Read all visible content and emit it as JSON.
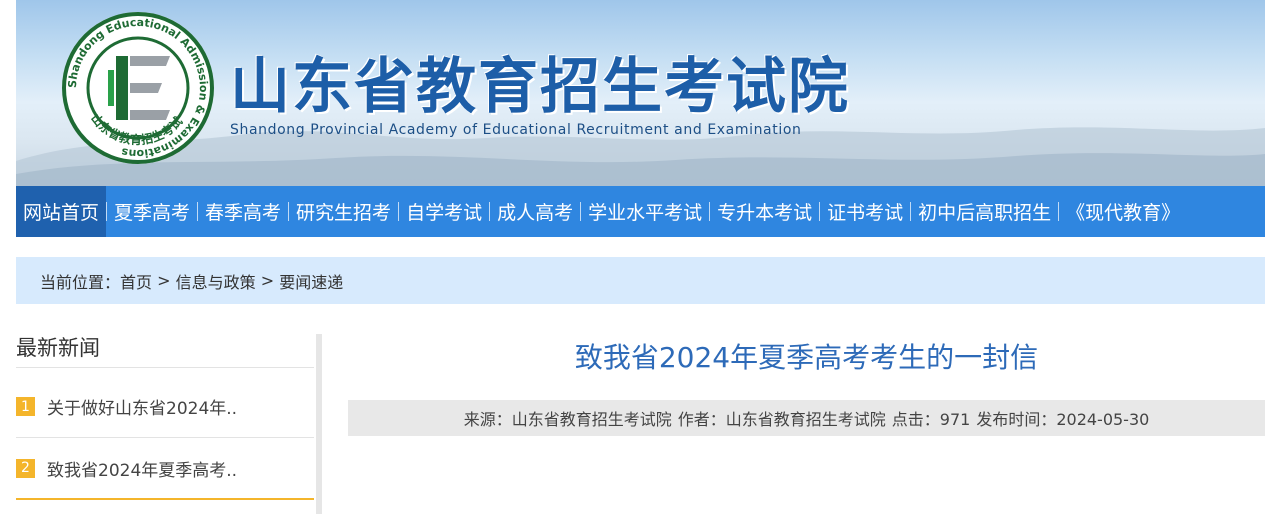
{
  "header": {
    "site_title": "山东省教育招生考试院",
    "site_subtitle": "Shandong Provincial Academy of Educational Recruitment and Examination",
    "logo": {
      "ring_text_en": "Shandong Educational Admission & Examinations",
      "ring_text_cn": "山东省教育招生考试",
      "letter": "E",
      "colors": {
        "ring": "#1e6b34",
        "accent": "#2aa14a"
      }
    }
  },
  "nav": {
    "items": [
      {
        "label": "网站首页",
        "active": true
      },
      {
        "label": "夏季高考"
      },
      {
        "label": "春季高考"
      },
      {
        "label": "研究生招考"
      },
      {
        "label": "自学考试"
      },
      {
        "label": "成人高考"
      },
      {
        "label": "学业水平考试"
      },
      {
        "label": "专升本考试"
      },
      {
        "label": "证书考试"
      },
      {
        "label": "初中后高职招生"
      },
      {
        "label": "《现代教育》"
      }
    ],
    "colors": {
      "bar": "#2f86e0",
      "active": "#1f61ae"
    }
  },
  "breadcrumb": {
    "prefix": "当前位置：",
    "items": [
      "首页",
      "信息与政策",
      "要闻速递"
    ],
    "separator": " > "
  },
  "sidebar": {
    "title": "最新新闻",
    "items": [
      {
        "num": "1",
        "text": "关于做好山东省2024年.."
      },
      {
        "num": "2",
        "text": "致我省2024年夏季高考.."
      }
    ]
  },
  "article": {
    "title": "致我省2024年夏季高考考生的一封信",
    "meta": {
      "source_label": "来源：",
      "source": "山东省教育招生考试院",
      "author_label": "作者：",
      "author": "山东省教育招生考试院",
      "clicks_label": "点击：",
      "clicks": "971",
      "date_label": "发布时间：",
      "date": "2024-05-30"
    }
  }
}
